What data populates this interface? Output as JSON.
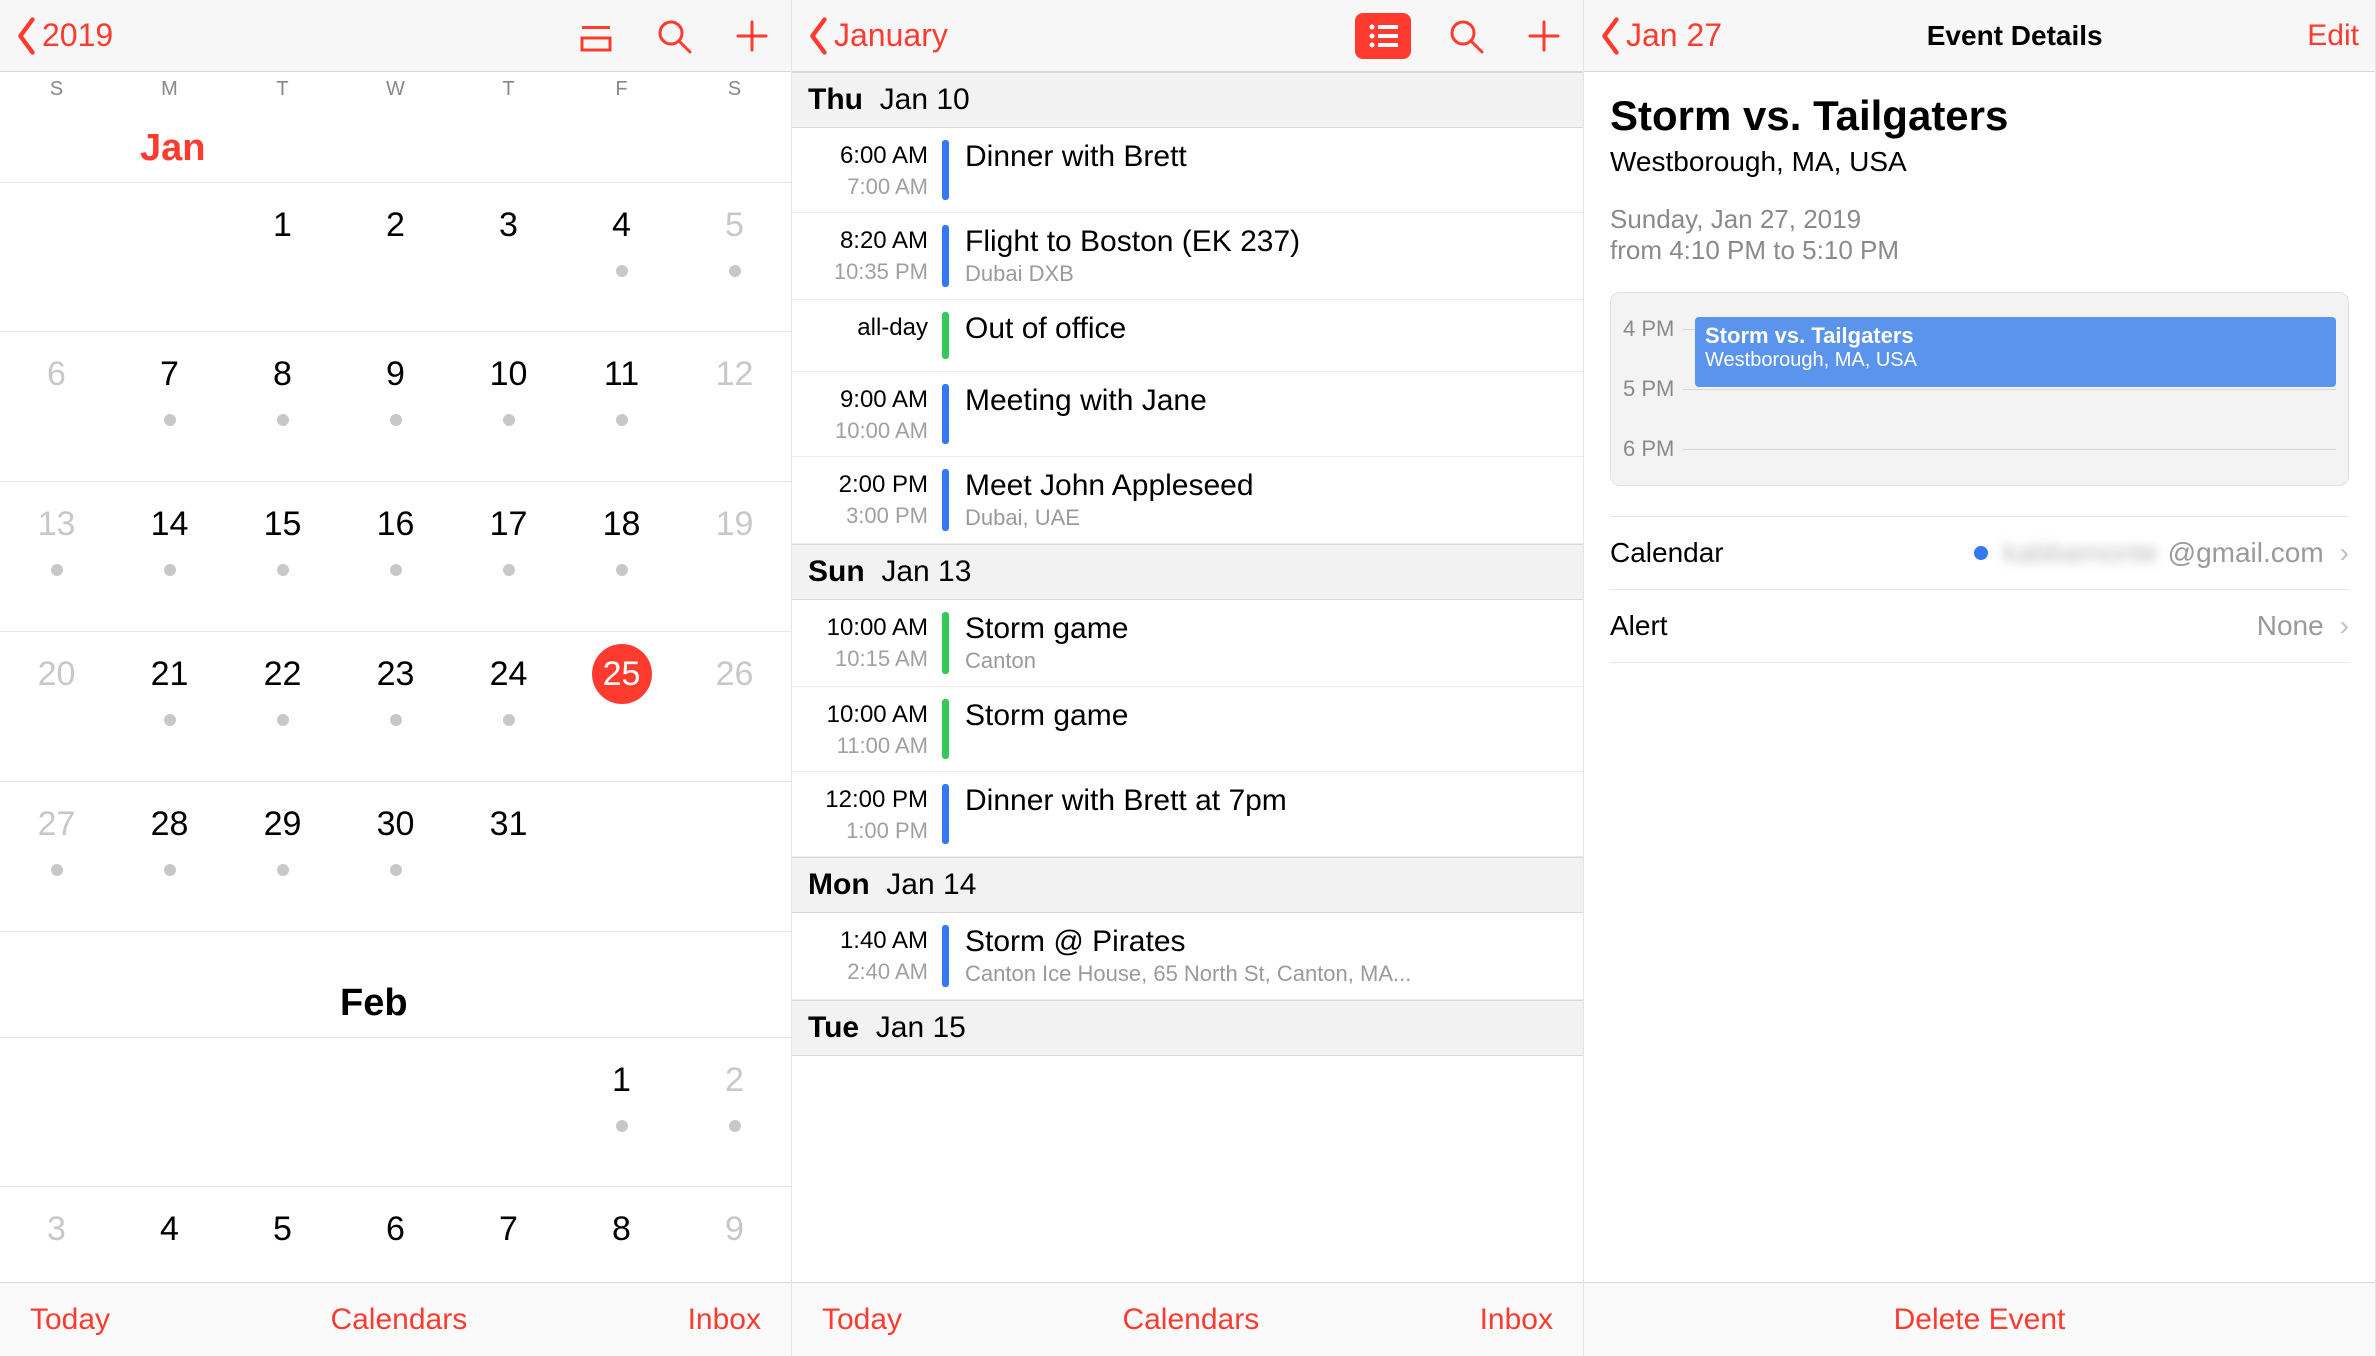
{
  "panel1": {
    "back": "2019",
    "weekdays": [
      "S",
      "M",
      "T",
      "W",
      "T",
      "F",
      "S"
    ],
    "month1": "Jan",
    "month2": "Feb",
    "today": "Today",
    "calendars": "Calendars",
    "inbox": "Inbox",
    "weeks_jan": [
      [
        {
          "n": "",
          "dot": false
        },
        {
          "n": "",
          "dot": false
        },
        {
          "n": "1",
          "dot": false
        },
        {
          "n": "2",
          "dot": false
        },
        {
          "n": "3",
          "dot": false
        },
        {
          "n": "4",
          "dot": true
        },
        {
          "n": "5",
          "dot": true,
          "grey": true
        }
      ],
      [
        {
          "n": "6",
          "dot": false,
          "grey": true
        },
        {
          "n": "7",
          "dot": true
        },
        {
          "n": "8",
          "dot": true
        },
        {
          "n": "9",
          "dot": true
        },
        {
          "n": "10",
          "dot": true
        },
        {
          "n": "11",
          "dot": true
        },
        {
          "n": "12",
          "dot": false,
          "grey": true
        }
      ],
      [
        {
          "n": "13",
          "dot": true,
          "grey": true
        },
        {
          "n": "14",
          "dot": true
        },
        {
          "n": "15",
          "dot": true
        },
        {
          "n": "16",
          "dot": true
        },
        {
          "n": "17",
          "dot": true
        },
        {
          "n": "18",
          "dot": true
        },
        {
          "n": "19",
          "dot": false,
          "grey": true
        }
      ],
      [
        {
          "n": "20",
          "dot": false,
          "grey": true
        },
        {
          "n": "21",
          "dot": true
        },
        {
          "n": "22",
          "dot": true
        },
        {
          "n": "23",
          "dot": true
        },
        {
          "n": "24",
          "dot": true
        },
        {
          "n": "25",
          "dot": false,
          "today": true
        },
        {
          "n": "26",
          "dot": false,
          "grey": true
        }
      ],
      [
        {
          "n": "27",
          "dot": true,
          "grey": true
        },
        {
          "n": "28",
          "dot": true
        },
        {
          "n": "29",
          "dot": true
        },
        {
          "n": "30",
          "dot": true
        },
        {
          "n": "31",
          "dot": false
        },
        {
          "n": "",
          "dot": false
        },
        {
          "n": "",
          "dot": false
        }
      ]
    ],
    "weeks_feb": [
      [
        {
          "n": "",
          "dot": false
        },
        {
          "n": "",
          "dot": false
        },
        {
          "n": "",
          "dot": false
        },
        {
          "n": "",
          "dot": false
        },
        {
          "n": "",
          "dot": false
        },
        {
          "n": "1",
          "dot": true
        },
        {
          "n": "2",
          "dot": true,
          "grey": true
        }
      ],
      [
        {
          "n": "3",
          "dot": false,
          "grey": true
        },
        {
          "n": "4",
          "dot": false
        },
        {
          "n": "5",
          "dot": false
        },
        {
          "n": "6",
          "dot": false
        },
        {
          "n": "7",
          "dot": false
        },
        {
          "n": "8",
          "dot": false
        },
        {
          "n": "9",
          "dot": false,
          "grey": true
        }
      ]
    ]
  },
  "panel2": {
    "back": "January",
    "today": "Today",
    "calendars": "Calendars",
    "inbox": "Inbox",
    "sections": [
      {
        "header_day": "Thu",
        "header_date": "Jan 10",
        "events": [
          {
            "t1": "6:00 AM",
            "t2": "7:00 AM",
            "color": "blue",
            "title": "Dinner with Brett"
          },
          {
            "t1": "8:20 AM",
            "t2": "10:35 PM",
            "color": "blue",
            "title": "Flight to Boston (EK 237)",
            "sub": "Dubai DXB"
          },
          {
            "t1": "all-day",
            "t2": "",
            "color": "green",
            "title": "Out of office"
          },
          {
            "t1": "9:00 AM",
            "t2": "10:00 AM",
            "color": "blue",
            "title": "Meeting with Jane"
          },
          {
            "t1": "2:00 PM",
            "t2": "3:00 PM",
            "color": "blue",
            "title": "Meet John Appleseed",
            "sub": "Dubai, UAE"
          }
        ]
      },
      {
        "header_day": "Sun",
        "header_date": "Jan 13",
        "events": [
          {
            "t1": "10:00 AM",
            "t2": "10:15 AM",
            "color": "green",
            "title": "Storm game",
            "sub": "Canton"
          },
          {
            "t1": "10:00 AM",
            "t2": "11:00 AM",
            "color": "green",
            "title": "Storm game"
          },
          {
            "t1": "12:00 PM",
            "t2": "1:00 PM",
            "color": "blue",
            "title": "Dinner with Brett at 7pm"
          }
        ]
      },
      {
        "header_day": "Mon",
        "header_date": "Jan 14",
        "events": [
          {
            "t1": "1:40 AM",
            "t2": "2:40 AM",
            "color": "blue",
            "title": "Storm @ Pirates",
            "sub": "Canton Ice House, 65 North St, Canton, MA..."
          }
        ]
      },
      {
        "header_day": "Tue",
        "header_date": "Jan 15",
        "events": []
      }
    ]
  },
  "panel3": {
    "back": "Jan 27",
    "title": "Event Details",
    "edit": "Edit",
    "event_title": "Storm vs. Tailgaters",
    "event_loc": "Westborough, MA, USA",
    "event_date": "Sunday, Jan 27, 2019",
    "event_time": "from 4:10 PM to 5:10 PM",
    "tl": {
      "h1": "4 PM",
      "h2": "5 PM",
      "h3": "6 PM",
      "et": "Storm vs. Tailgaters",
      "es": "Westborough, MA, USA"
    },
    "rows": {
      "cal_label": "Calendar",
      "cal_account_blur": "kabbamonte",
      "cal_account_suffix": "@gmail.com",
      "alert_label": "Alert",
      "alert_value": "None"
    },
    "delete": "Delete Event"
  }
}
